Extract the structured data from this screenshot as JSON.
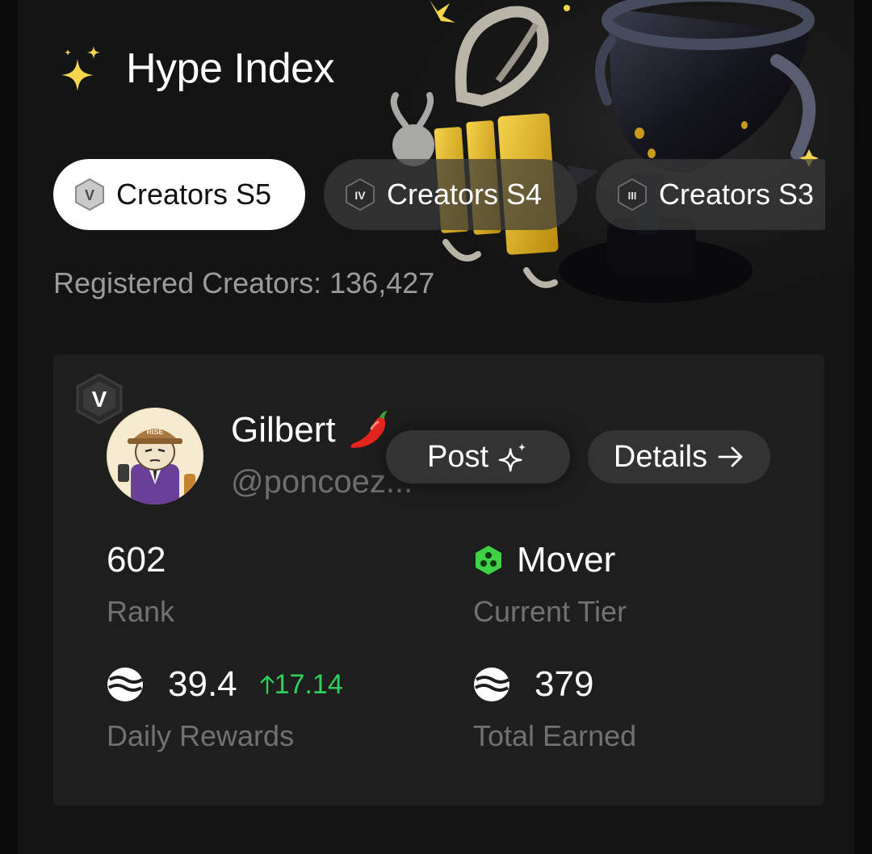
{
  "header": {
    "title": "Hype Index"
  },
  "tabs": [
    {
      "label": "Creators S5",
      "badge": "V",
      "active": true
    },
    {
      "label": "Creators S4",
      "badge": "IV",
      "active": false
    },
    {
      "label": "Creators S3",
      "badge": "III",
      "active": false
    }
  ],
  "registered_creators": "Registered Creators: 136,427",
  "profile": {
    "tier_badge": "V",
    "name": "Gilbert",
    "handle": "@poncoez...",
    "avatar_hat_text": "RISE",
    "post_label": "Post",
    "details_label": "Details"
  },
  "stats": {
    "rank": {
      "value": "602",
      "label": "Rank"
    },
    "tier": {
      "value": "Mover",
      "label": "Current Tier"
    },
    "daily_rewards": {
      "value": "39.4",
      "delta": "17.14",
      "label": "Daily Rewards"
    },
    "total_earned": {
      "value": "379",
      "label": "Total Earned"
    }
  },
  "colors": {
    "background": "#141414",
    "card": "#1e1e1e",
    "accent_green": "#2fd15d",
    "sparkle_yellow": "#f6d64a",
    "muted_text": "#9b9b9b"
  },
  "icons": [
    "sparkles-icon",
    "hex-badge-icon",
    "chili-pepper-icon",
    "sparkle-icon",
    "arrow-right-icon",
    "mover-tier-icon",
    "coin-icon",
    "arrow-up-icon",
    "trophy-illustration"
  ]
}
